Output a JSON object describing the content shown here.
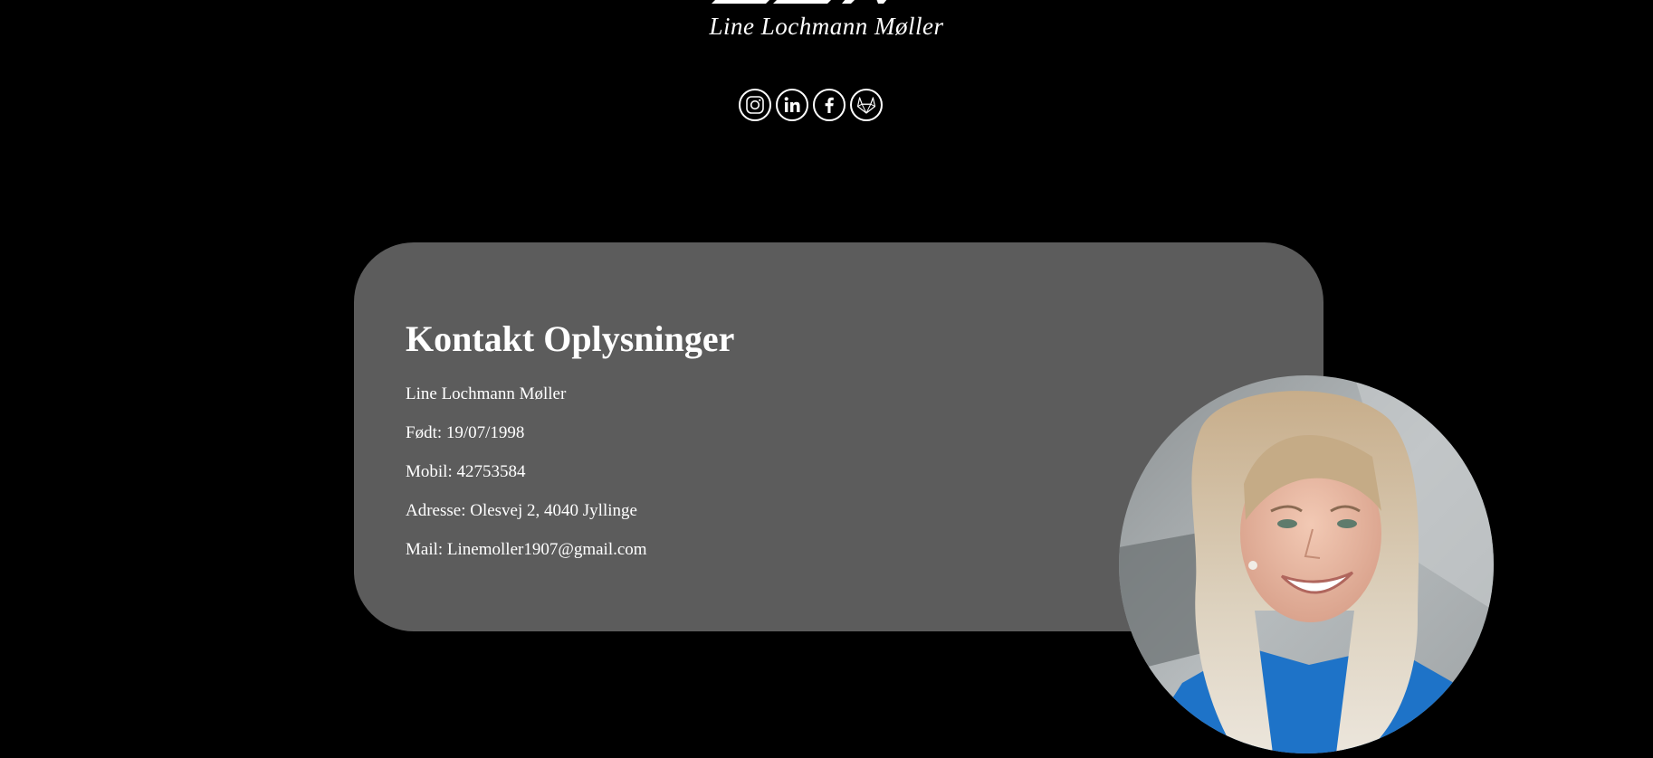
{
  "header": {
    "name": "Line Lochmann Møller",
    "logo_mark": "LLM"
  },
  "social_links": [
    {
      "name": "instagram-icon",
      "label": "Instagram"
    },
    {
      "name": "linkedin-icon",
      "label": "LinkedIn"
    },
    {
      "name": "facebook-icon",
      "label": "Facebook"
    },
    {
      "name": "gitlab-icon",
      "label": "GitLab"
    }
  ],
  "contact": {
    "title": "Kontakt Oplysninger",
    "lines": [
      "Line Lochmann Møller",
      "Født: 19/07/1998",
      "Mobil: 42753584",
      "Adresse: Olesvej 2, 4040 Jyllinge",
      "Mail: Linemoller1907@gmail.com"
    ]
  },
  "colors": {
    "background": "#000000",
    "card": "#5c5c5c",
    "text": "#ffffff",
    "shirt": "#1e73c8",
    "hair": "#d8c6a8"
  }
}
